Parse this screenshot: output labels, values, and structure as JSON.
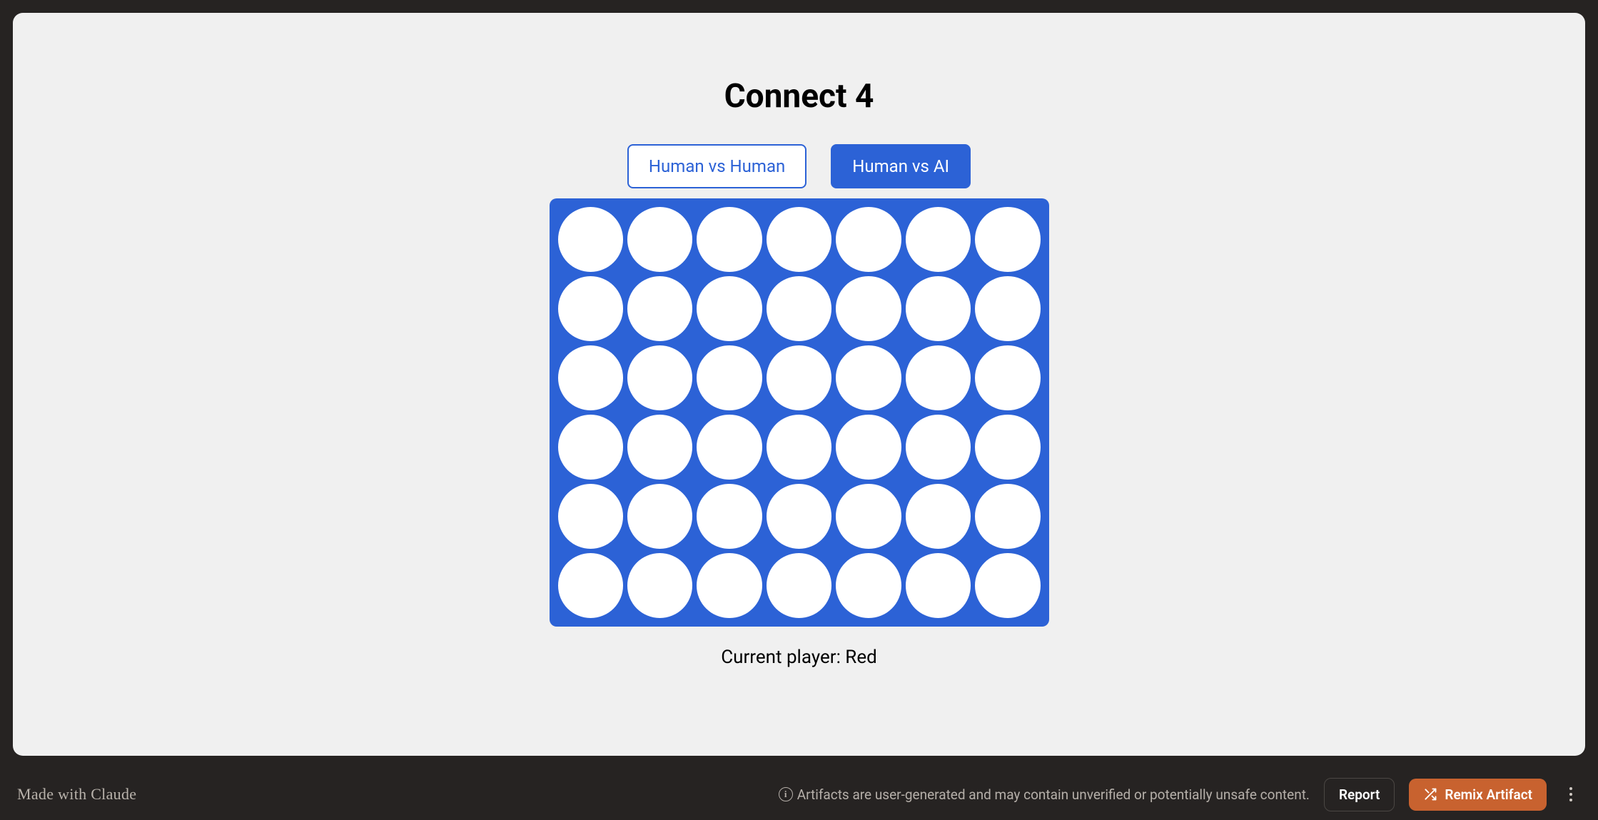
{
  "title": "Connect 4",
  "modes": {
    "human_vs_human": "Human vs Human",
    "human_vs_ai": "Human vs AI",
    "selected": "human_vs_ai"
  },
  "board": {
    "columns": 7,
    "rows": 6,
    "cells": [
      [
        "empty",
        "empty",
        "empty",
        "empty",
        "empty",
        "empty",
        "empty"
      ],
      [
        "empty",
        "empty",
        "empty",
        "empty",
        "empty",
        "empty",
        "empty"
      ],
      [
        "empty",
        "empty",
        "empty",
        "empty",
        "empty",
        "empty",
        "empty"
      ],
      [
        "empty",
        "empty",
        "empty",
        "empty",
        "empty",
        "empty",
        "empty"
      ],
      [
        "empty",
        "empty",
        "empty",
        "empty",
        "empty",
        "empty",
        "empty"
      ],
      [
        "empty",
        "empty",
        "empty",
        "empty",
        "empty",
        "empty",
        "empty"
      ]
    ]
  },
  "status": "Current player: Red",
  "footer": {
    "made_with": "Made with Claude",
    "disclaimer": "Artifacts are user-generated and may contain unverified or potentially unsafe content.",
    "report": "Report",
    "remix": "Remix Artifact"
  },
  "colors": {
    "board_blue": "#2c62d6",
    "remix_orange": "#c8622f",
    "frame_dark": "#262322",
    "panel_bg": "#f0f0f0"
  }
}
